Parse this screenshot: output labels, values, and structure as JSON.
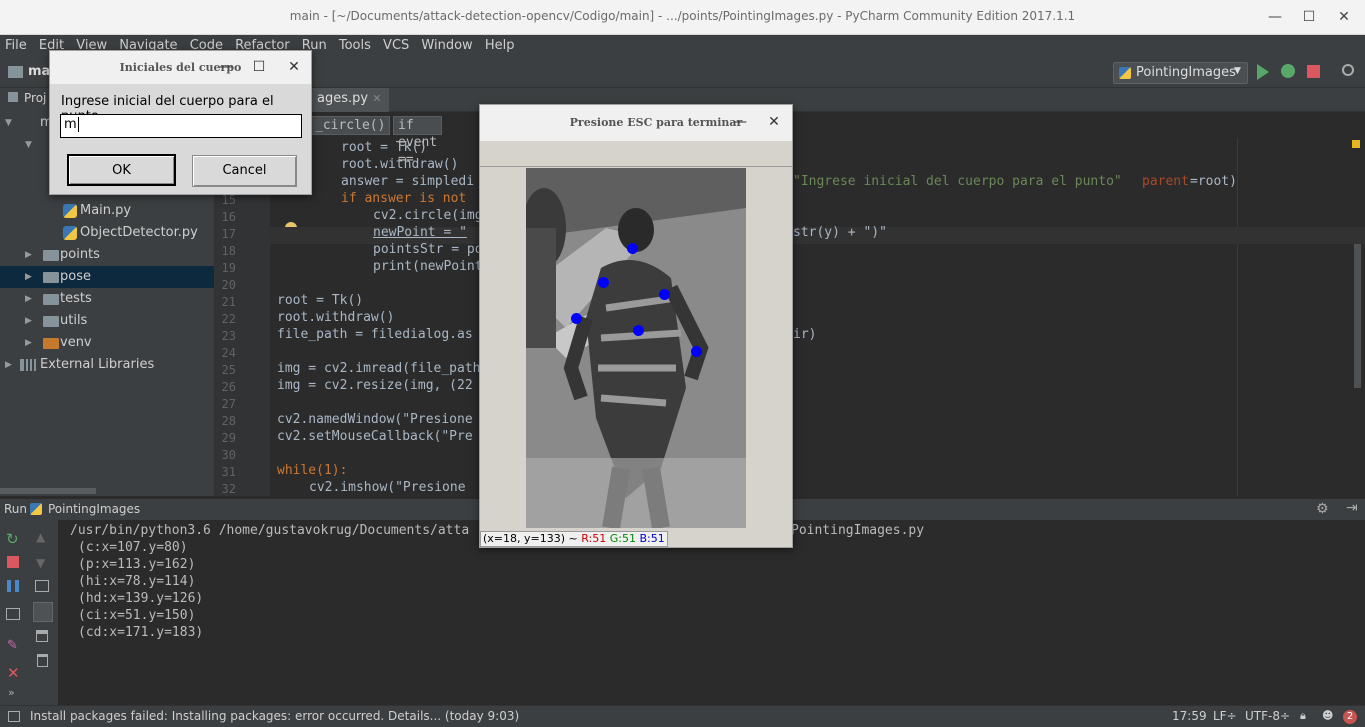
{
  "window": {
    "title": "main - [~/Documents/attack-detection-opencv/Codigo/main] - .../points/PointingImages.py - PyCharm Community Edition 2017.1.1",
    "minimize": "—",
    "maximize": "☐",
    "close": "✕"
  },
  "menu": [
    "File",
    "Edit",
    "View",
    "Navigate",
    "Code",
    "Refactor",
    "Run",
    "Tools",
    "VCS",
    "Window",
    "Help"
  ],
  "navbar": {
    "project_crumb": "ma",
    "run_config": "PointingImages"
  },
  "project_panel": {
    "tab": "Proj",
    "root": "m",
    "items": [
      {
        "label": "Main.py",
        "type": "py"
      },
      {
        "label": "ObjectDetector.py",
        "type": "py"
      },
      {
        "label": "points",
        "type": "folder"
      },
      {
        "label": "pose",
        "type": "folder"
      },
      {
        "label": "tests",
        "type": "folder"
      },
      {
        "label": "utils",
        "type": "folder"
      },
      {
        "label": "venv",
        "type": "folder"
      },
      {
        "label": "External Libraries",
        "type": "lib"
      }
    ]
  },
  "editor": {
    "tab_label": "ages.py",
    "crumbs": [
      "_circle()",
      "if event =="
    ],
    "line_numbers": [
      "15",
      "16",
      "17",
      "18",
      "19",
      "20",
      "21",
      "22",
      "23",
      "24",
      "25",
      "26",
      "27",
      "28",
      "29",
      "30",
      "31",
      "32"
    ],
    "lines": [
      "root = Tk()",
      "root.withdraw()",
      "answer = simpledi",
      "if answer is not",
      "cv2.circle(img",
      "newPoint = \"",
      "pointsStr = po",
      "print(newPoint",
      "root = Tk()",
      "root.withdraw()",
      "file_path = filedialog.as",
      "img = cv2.imread(file_path",
      "img = cv2.resize(img, (22",
      "cv2.namedWindow(\"Presione",
      "cv2.setMouseCallback(\"Pre",
      "while(1):",
      "cv2.imshow(\"Presione"
    ],
    "right_snippets": {
      "prompt_arg": "\"Ingrese inicial del cuerpo para el punto\"",
      "parent": "parent",
      "root": "=root)",
      "str_y": "str(y) + \")\"",
      "ir": "ir)"
    }
  },
  "run_panel": {
    "label": "Run",
    "config": "PointingImages",
    "command": "/usr/bin/python3.6 /home/gustavokrug/Documents/atta",
    "command_tail": "PointingImages.py",
    "output": [
      "(c:x=107.y=80)",
      "(p:x=113.y=162)",
      "(hi:x=78.y=114)",
      "(hd:x=139.y=126)",
      "(ci:x=51.y=150)",
      "(cd:x=171.y=183)"
    ]
  },
  "status_bar": {
    "message": "Install packages failed: Installing packages: error occurred. Details... (today 9:03)",
    "position": "17:59",
    "line_sep": "LF÷",
    "encoding": "UTF-8÷",
    "notifications": "2"
  },
  "dialog_initials": {
    "title": "Iniciales del cuerpo",
    "prompt": "Ingrese inicial del cuerpo para el punto",
    "input_value": "m",
    "ok": "OK",
    "cancel": "Cancel"
  },
  "opencv_window": {
    "title": "Presione ESC para terminar",
    "coords": "(x=18, y=133) ~",
    "r": "R:51",
    "g": "G:51",
    "b": "B:51"
  },
  "colors": {
    "accent_blue": "#0000ff",
    "ide_bg": "#2b2b2b",
    "panel_bg": "#3c3f41"
  }
}
